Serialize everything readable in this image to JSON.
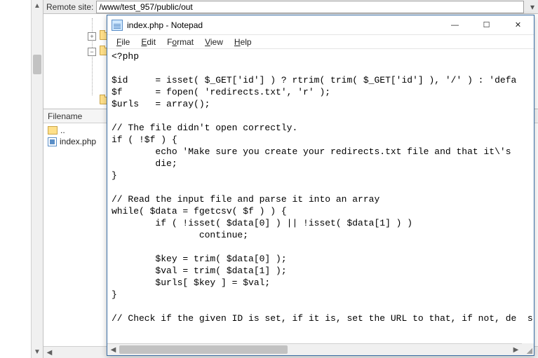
{
  "ftp": {
    "remote_label": "Remote site:",
    "remote_path": "/www/test_957/public/out",
    "filename_header": "Filename",
    "up_label": "..",
    "files": [
      "index.php"
    ]
  },
  "notepad": {
    "title": "index.php - Notepad",
    "menu": {
      "file": "File",
      "edit": "Edit",
      "format": "Format",
      "view": "View",
      "help": "Help"
    },
    "btn": {
      "min": "—",
      "max": "☐",
      "close": "✕"
    },
    "code": "<?php\n\n$id     = isset( $_GET['id'] ) ? rtrim( trim( $_GET['id'] ), '/' ) : 'defa\n$f      = fopen( 'redirects.txt', 'r' );\n$urls   = array();\n\n// The file didn't open correctly.\nif ( !$f ) {\n        echo 'Make sure you create your redirects.txt file and that it\\'s \n        die;\n}\n\n// Read the input file and parse it into an array\nwhile( $data = fgetcsv( $f ) ) {\n        if ( !isset( $data[0] ) || !isset( $data[1] ) )\n                continue;\n\n        $key = trim( $data[0] );\n        $val = trim( $data[1] );\n        $urls[ $key ] = $val;\n}\n\n// Check if the given ID is set, if it is, set the URL to that, if not, de  s"
  }
}
